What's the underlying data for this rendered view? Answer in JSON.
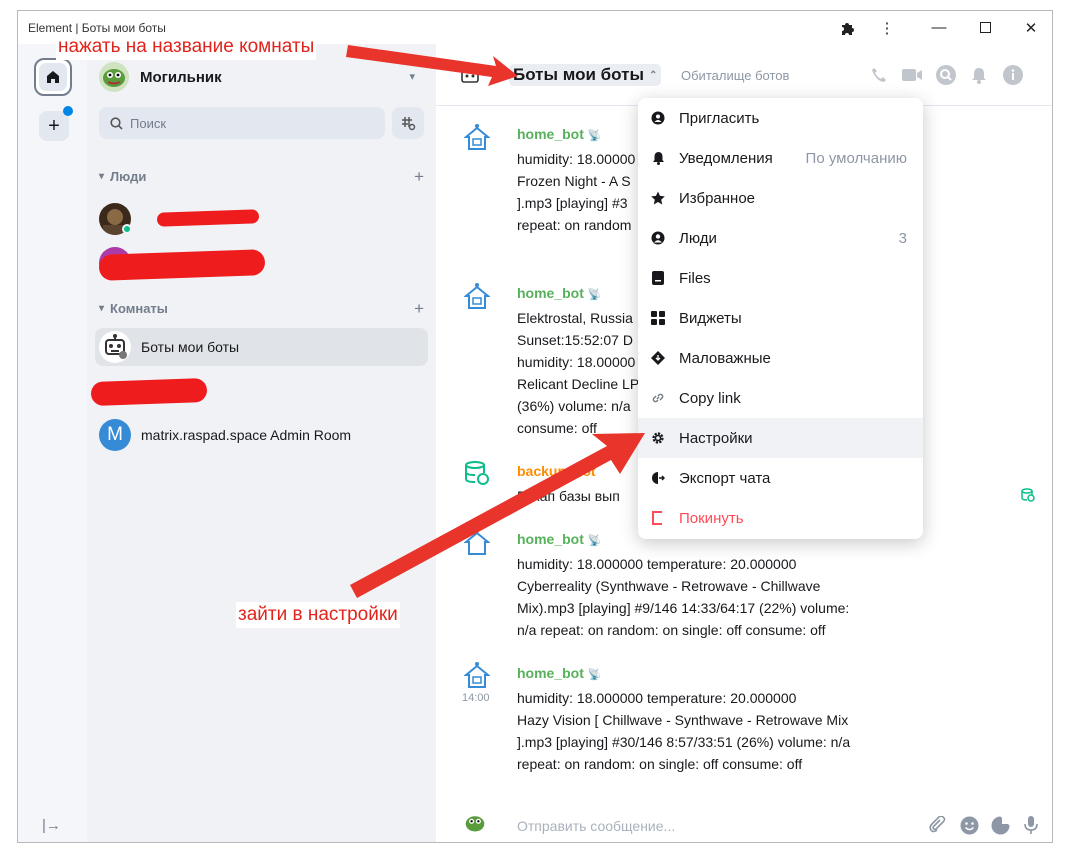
{
  "window": {
    "title": "Element | Боты мои боты"
  },
  "colors": {
    "accent": "#0dbd8b",
    "bot_name": "#57b15b",
    "backup_name": "#ff8c00",
    "danger": "#ff4b55",
    "annotation": "#e0241b"
  },
  "space": {
    "name": "Могильник"
  },
  "search": {
    "placeholder": "Поиск"
  },
  "sections": {
    "people": "Люди",
    "rooms": "Комнаты"
  },
  "rooms": [
    {
      "name": "Боты мои боты",
      "icon": "robot-avatar",
      "selected": true
    },
    {
      "name": "matrix.raspad.space Admin Room",
      "avatar_letter": "M"
    }
  ],
  "header": {
    "room_name": "Боты мои боты",
    "topic": "Обиталище ботов"
  },
  "messages": [
    {
      "sender": "home_bot",
      "lines": [
        "humidity: 18.00000",
        "Frozen Night - A S",
        "].mp3 [playing] #3",
        "repeat: on random"
      ]
    },
    {
      "sender": "home_bot",
      "lines": [
        "Elektrostal, Russia",
        "Sunset:15:52:07 D",
        "humidity: 18.00000",
        "Relicant Decline LP",
        "(36%) volume: n/a",
        "consume: off"
      ]
    },
    {
      "sender": "backup_bot",
      "lines": [
        "Бэкап базы вып"
      ]
    },
    {
      "sender": "home_bot",
      "lines": [
        "humidity: 18.000000 temperature: 20.000000",
        "Cyberreality (Synthwave - Retrowave - Chillwave",
        "Mix).mp3 [playing] #9/146 14:33/64:17 (22%) volume:",
        "n/a repeat: on random: on single: off consume: off"
      ]
    },
    {
      "sender": "home_bot",
      "time": "14:00",
      "lines": [
        "humidity: 18.000000 temperature: 20.000000",
        "Hazy Vision [ Chillwave - Synthwave - Retrowave Mix",
        "].mp3 [playing] #30/146 8:57/33:51 (26%) volume: n/a",
        "repeat: on random: on single: off consume: off"
      ]
    }
  ],
  "composer": {
    "placeholder": "Отправить сообщение..."
  },
  "context_menu": {
    "items": [
      {
        "label": "Пригласить",
        "icon": "invite-icon"
      },
      {
        "label": "Уведомления",
        "icon": "bell-icon",
        "extra": "По умолчанию"
      },
      {
        "label": "Избранное",
        "icon": "star-icon"
      },
      {
        "label": "Люди",
        "icon": "people-icon",
        "extra": "3"
      },
      {
        "label": "Files",
        "icon": "files-icon"
      },
      {
        "label": "Виджеты",
        "icon": "widgets-icon"
      },
      {
        "label": "Маловажные",
        "icon": "low-priority-icon"
      },
      {
        "label": "Copy link",
        "icon": "link-icon"
      },
      {
        "label": "Настройки",
        "icon": "settings-icon"
      },
      {
        "label": "Экспорт чата",
        "icon": "export-icon"
      },
      {
        "label": "Покинуть",
        "icon": "leave-icon"
      }
    ]
  },
  "annotations": {
    "click_room_name": "нажать на название комнаты",
    "go_to_settings": "зайти в настройки"
  }
}
